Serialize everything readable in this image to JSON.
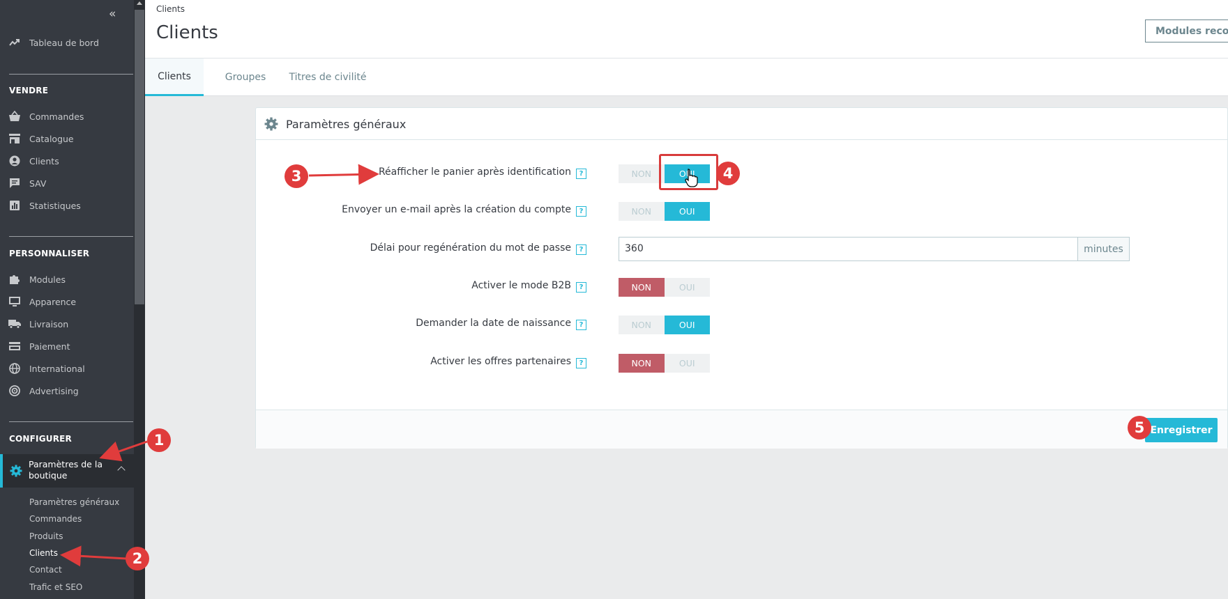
{
  "sidebar": {
    "dashboard": "Tableau de bord",
    "section_sell": "VENDRE",
    "sell_items": [
      "Commandes",
      "Catalogue",
      "Clients",
      "SAV",
      "Statistiques"
    ],
    "section_customize": "PERSONNALISER",
    "customize_items": [
      "Modules",
      "Apparence",
      "Livraison",
      "Paiement",
      "International",
      "Advertising"
    ],
    "section_configure": "CONFIGURER",
    "active_item": "Paramètres de la boutique",
    "sub_items": [
      "Paramètres généraux",
      "Commandes",
      "Produits",
      "Clients",
      "Contact",
      "Trafic et SEO"
    ],
    "active_sub": 3
  },
  "header": {
    "breadcrumb": "Clients",
    "title": "Clients",
    "modules_button": "Modules recom"
  },
  "tabs": [
    {
      "label": "Clients",
      "active": true
    },
    {
      "label": "Groupes",
      "active": false
    },
    {
      "label": "Titres de civilité",
      "active": false
    }
  ],
  "panel": {
    "title": "Paramètres généraux",
    "help_symbol": "?",
    "no_label": "NON",
    "yes_label": "OUI",
    "rows": [
      {
        "label": "Réafficher le panier après identification",
        "value": "OUI"
      },
      {
        "label": "Envoyer un e-mail après la création du compte",
        "value": "OUI"
      },
      {
        "label": "Délai pour regénération du mot de passe",
        "input_value": "360",
        "unit": "minutes"
      },
      {
        "label": "Activer le mode B2B",
        "value": "NON"
      },
      {
        "label": "Demander la date de naissance",
        "value": "OUI"
      },
      {
        "label": "Activer les offres partenaires",
        "value": "NON"
      }
    ],
    "save_button": "Enregistrer"
  },
  "annotations": {
    "badges": [
      "1",
      "2",
      "3",
      "4",
      "5"
    ],
    "color": "#e03c3c"
  },
  "colors": {
    "accent": "#25b9d7",
    "danger": "#c05c67",
    "sidebar_bg": "#363a41"
  }
}
